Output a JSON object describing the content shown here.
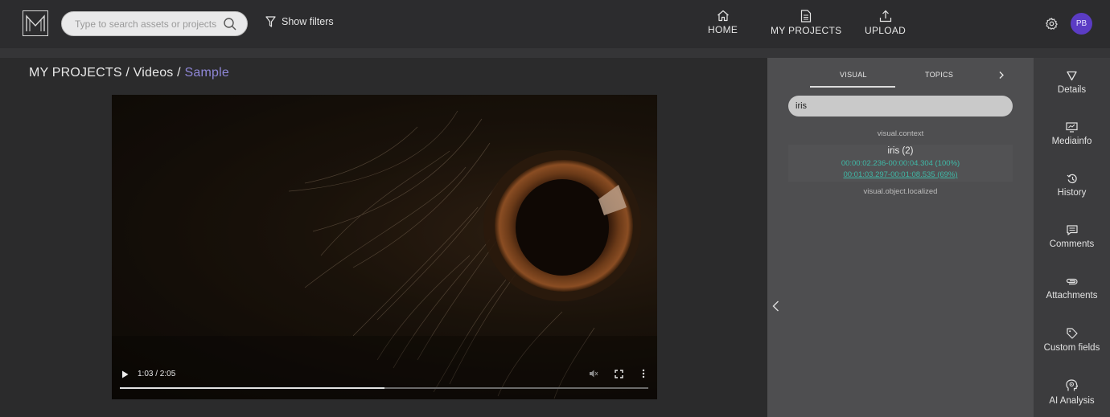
{
  "header": {
    "logo_letter": "M",
    "search_placeholder": "Type to search assets or projects",
    "filters_label": "Show filters",
    "nav": [
      {
        "label": "HOME",
        "icon": "home-icon"
      },
      {
        "label": "MY PROJECTS",
        "icon": "document-icon"
      },
      {
        "label": "UPLOAD",
        "icon": "upload-icon"
      }
    ],
    "avatar_initials": "PB"
  },
  "breadcrumb": {
    "root": "MY PROJECTS",
    "sep": "/",
    "folder": "Videos",
    "current": "Sample"
  },
  "player": {
    "time": "1:03 / 2:05",
    "progress": 0.5
  },
  "panel": {
    "tabs": [
      "VISUAL",
      "TOPICS"
    ],
    "active_tab": "VISUAL",
    "filter_value": "iris",
    "context_label": "visual.context",
    "result": {
      "name": "iris (2)",
      "timestamps": [
        "00:00:02.236-00:00:04.304 (100%)",
        "00:01:03.297-00:01:08.535 (69%)"
      ]
    },
    "localized_label": "visual.object.localized"
  },
  "sidebar": {
    "items": [
      {
        "label": "Details",
        "icon": "funnel-icon"
      },
      {
        "label": "Mediainfo",
        "icon": "monitor-icon"
      },
      {
        "label": "History",
        "icon": "history-icon"
      },
      {
        "label": "Comments",
        "icon": "comment-icon"
      },
      {
        "label": "Attachments",
        "icon": "paperclip-icon"
      },
      {
        "label": "Custom fields",
        "icon": "tag-icon"
      },
      {
        "label": "AI Analysis",
        "icon": "ai-head-icon"
      }
    ],
    "active": "AI Analysis"
  },
  "colors": {
    "accent_purple": "#8e86d6",
    "avatar_bg": "#5b3cc4",
    "timestamp_teal": "#3fb9a7"
  }
}
